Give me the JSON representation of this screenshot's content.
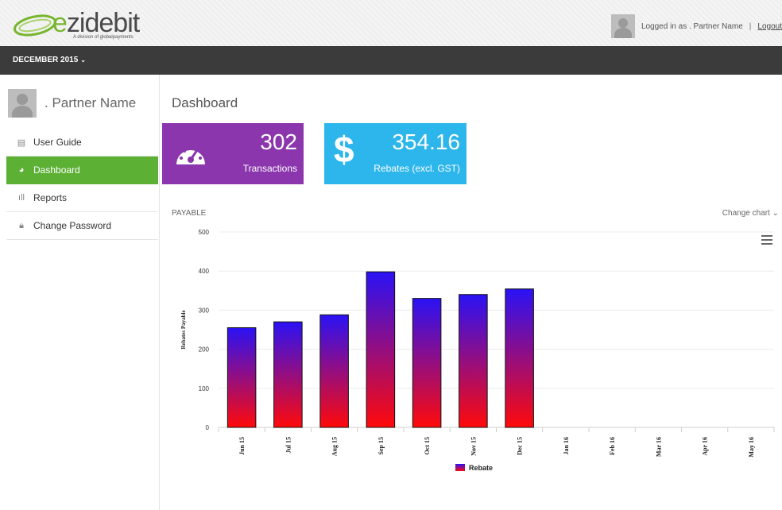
{
  "header": {
    "logo_text_a": "e",
    "logo_text_b": "zidebit",
    "logo_tagline": "A division of globalpayments",
    "logged_in_text": "Logged in as . Partner Name",
    "separator": "|",
    "logout_label": "Logout"
  },
  "monthbar": {
    "selected_month": "DECEMBER 2015"
  },
  "sidebar": {
    "user_name": ". Partner Name",
    "items": [
      {
        "label": "User Guide",
        "icon": "document-icon",
        "active": false
      },
      {
        "label": "Dashboard",
        "icon": "gauge-icon",
        "active": true
      },
      {
        "label": "Reports",
        "icon": "bar-chart-icon",
        "active": false
      },
      {
        "label": "Change Password",
        "icon": "lock-icon",
        "active": false
      }
    ]
  },
  "main": {
    "title": "Dashboard",
    "cards": {
      "transactions": {
        "value": "302",
        "label": "Transactions",
        "color": "#8b36ad",
        "icon": "gauge-icon"
      },
      "rebates": {
        "value": "354.16",
        "label": "Rebates (excl. GST)",
        "color": "#2db6ec",
        "icon": "dollar-icon"
      }
    },
    "chart_section_label": "PAYABLE",
    "change_chart_label": "Change chart"
  },
  "chart_data": {
    "type": "bar",
    "title": "",
    "ylabel": "Rebates Payable",
    "xlabel": "",
    "categories": [
      "Jun 15",
      "Jul 15",
      "Aug 15",
      "Sep 15",
      "Oct 15",
      "Nov 15",
      "Dec 15",
      "Jan 16",
      "Feb 16",
      "Mar 16",
      "Apr 16",
      "May 16"
    ],
    "series": [
      {
        "name": "Rebate",
        "values": [
          255,
          270,
          288,
          398,
          330,
          340,
          354.16,
          0,
          0,
          0,
          0,
          0
        ]
      }
    ],
    "ylim": [
      0,
      500
    ],
    "yticks": [
      0,
      100,
      200,
      300,
      400,
      500
    ],
    "grid": true,
    "legend_position": "bottom",
    "bar_gradient": {
      "top": "#2a12f5",
      "bottom": "#ff0a0a"
    }
  }
}
